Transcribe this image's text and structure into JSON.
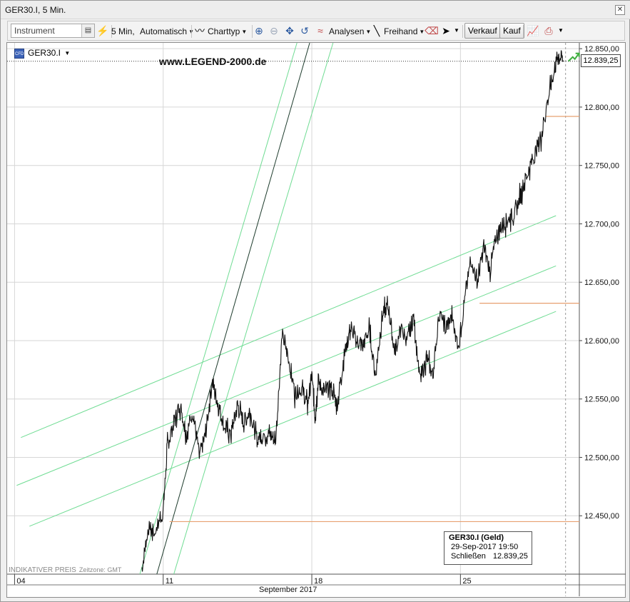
{
  "window": {
    "title": "GER30.I, 5 Min."
  },
  "toolbar": {
    "instrument_placeholder": "Instrument",
    "interval_label": "5 Min,",
    "scale_label": "Automatisch",
    "charttype_label": "Charttyp",
    "analysen_label": "Analysen",
    "freihand_label": "Freihand",
    "verkauf_label": "Verkauf",
    "kauf_label": "Kauf"
  },
  "chart_header": {
    "symbol": "GER30.I",
    "badge": "CFD",
    "watermark": "www.LEGEND-2000.de"
  },
  "footer": {
    "indicative": "INDIKATIVER PREIS",
    "timezone": "Zeitzone: GMT",
    "month": "September 2017"
  },
  "info_box": {
    "title": "GER30.I (Geld)",
    "datetime": "29-Sep-2017 19:50",
    "close_label": "Schließen",
    "close_value": "12.839,25"
  },
  "last_price_flag": "12.839,25",
  "colors": {
    "price_line": "#111111",
    "channel_green": "#6fdc93",
    "trend_dark": "#1d3b2c",
    "support_orange": "#e8a070",
    "grid": "#d6d6d6",
    "up_arrow": "#3fae3f"
  },
  "chart_data": {
    "type": "line",
    "title": "GER30.I, 5 Min.",
    "x_ticks": [
      "04",
      "11",
      "18",
      "25"
    ],
    "x_tick_label_days": [
      4,
      11,
      18,
      25
    ],
    "month_label": "September 2017",
    "ylim": [
      12400,
      12855
    ],
    "y_ticks": [
      12450,
      12500,
      12550,
      12600,
      12650,
      12700,
      12750,
      12800,
      12850
    ],
    "y_tick_labels": [
      "12.450,00",
      "12.500,00",
      "12.550,00",
      "12.600,00",
      "12.650,00",
      "12.700,00",
      "12.750,00",
      "12.800,00",
      "12.850,00"
    ],
    "last_value": 12839.25,
    "last_value_label": "12.839,25",
    "series": [
      {
        "values_x_day": [
          10.0,
          10.3,
          10.6,
          11.0,
          11.2,
          11.5,
          11.8,
          12.1,
          12.4,
          12.7,
          13.0,
          13.3,
          13.6,
          13.9,
          14.2,
          14.5,
          14.8,
          15.1,
          15.4,
          15.7,
          16.0,
          16.3,
          16.6,
          16.9,
          17.2,
          17.5,
          17.8,
          18.0,
          18.15,
          18.3,
          18.6,
          18.9,
          19.2,
          19.5,
          19.8,
          20.1,
          20.4,
          20.7,
          21.0,
          21.3,
          21.6,
          21.9,
          22.2,
          22.5,
          22.8,
          23.1,
          23.4,
          23.7,
          24.0,
          24.3,
          24.6,
          24.9,
          25.2,
          25.5,
          25.8,
          26.1,
          26.4,
          26.7,
          27.0,
          27.3,
          27.6,
          27.9,
          28.2,
          28.5,
          28.8,
          29.1,
          29.4,
          29.6,
          29.85
        ],
        "values_y": [
          12405,
          12440,
          12435,
          12455,
          12510,
          12530,
          12545,
          12520,
          12540,
          12500,
          12520,
          12565,
          12545,
          12525,
          12520,
          12545,
          12530,
          12540,
          12515,
          12520,
          12520,
          12515,
          12605,
          12585,
          12555,
          12560,
          12545,
          12570,
          12535,
          12565,
          12555,
          12560,
          12545,
          12585,
          12610,
          12600,
          12595,
          12610,
          12570,
          12620,
          12630,
          12590,
          12610,
          12600,
          12620,
          12565,
          12585,
          12570,
          12625,
          12610,
          12620,
          12595,
          12635,
          12670,
          12650,
          12680,
          12660,
          12690,
          12700,
          12705,
          12710,
          12730,
          12745,
          12760,
          12775,
          12805,
          12830,
          12845,
          12839.25
        ]
      }
    ],
    "channel_upper_dates": [
      4.3,
      29.5
    ],
    "channel_upper_values": [
      12517,
      12707
    ],
    "channel_mid_dates": [
      4.1,
      29.5
    ],
    "channel_mid_values": [
      12476,
      12664
    ],
    "channel_lower_dates": [
      4.7,
      29.5
    ],
    "channel_lower_values": [
      12441,
      12625
    ],
    "steep_dark_dates": [
      10.7,
      17.9
    ],
    "steep_dark_values": [
      12400,
      12855
    ],
    "steep_green_a_dates": [
      9.9,
      17.3
    ],
    "steep_green_a_values": [
      12400,
      12855
    ],
    "steep_green_b_dates": [
      11.5,
      19.0
    ],
    "steep_green_b_values": [
      12400,
      12855
    ],
    "support_levels": [
      {
        "value": 12445,
        "from_day": 11.3,
        "to_day": 30.6
      },
      {
        "value": 12632,
        "from_day": 25.9,
        "to_day": 30.6
      },
      {
        "value": 12792,
        "from_day": 29.0,
        "to_day": 30.6
      }
    ],
    "grid": true,
    "legend": "none"
  }
}
